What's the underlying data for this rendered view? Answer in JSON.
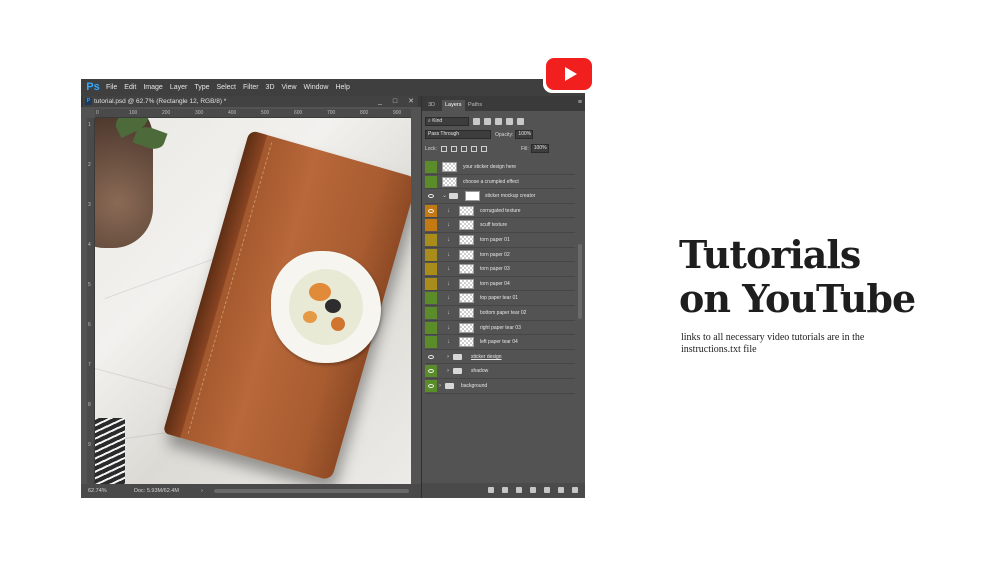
{
  "menubar": {
    "logo": "Ps",
    "items": [
      "File",
      "Edit",
      "Image",
      "Layer",
      "Type",
      "Select",
      "Filter",
      "3D",
      "View",
      "Window",
      "Help"
    ]
  },
  "document": {
    "tab_title": "tutorial.psd @ 62.7% (Rectangle 12, RGB/8) *",
    "window_controls": [
      "_",
      "□",
      "✕"
    ],
    "ruler_h": [
      "0",
      "100",
      "200",
      "300",
      "400",
      "500",
      "600",
      "700",
      "800",
      "900"
    ],
    "ruler_v": [
      "1",
      "2",
      "3",
      "4",
      "5",
      "6",
      "7",
      "8",
      "9"
    ]
  },
  "statusbar": {
    "zoom": "62.74%",
    "doc_info": "Doc: 5.93M/62.4M",
    "arrow": "›"
  },
  "panel": {
    "tabs": [
      "3D",
      "Layers",
      "Paths"
    ],
    "active_tab": "Layers",
    "menu_icon": "≡",
    "filter_kind": "Kind",
    "blend_mode": "Pass Through",
    "opacity_label": "Opacity:",
    "opacity_value": "100%",
    "lock_label": "Lock:",
    "fill_label": "Fill:",
    "fill_value": "100%",
    "layers": [
      {
        "name": "your sticker design here",
        "vis": "green",
        "eye": false,
        "thumb": "checker",
        "indent": 1
      },
      {
        "name": "choose a crumpled effect",
        "vis": "green",
        "eye": false,
        "thumb": "checker",
        "indent": 1
      },
      {
        "name": "sticker mockup creator",
        "vis": "none",
        "eye": true,
        "thumb": "folder-white",
        "indent": 0
      },
      {
        "name": "corrugated texture",
        "vis": "orange",
        "eye": true,
        "thumb": "checker",
        "indent": 2
      },
      {
        "name": "scuff texture",
        "vis": "orange",
        "eye": false,
        "thumb": "checker",
        "indent": 2
      },
      {
        "name": "torn paper 01",
        "vis": "olive",
        "eye": false,
        "thumb": "checker",
        "indent": 2
      },
      {
        "name": "torn paper 02",
        "vis": "olive",
        "eye": false,
        "thumb": "checker",
        "indent": 2
      },
      {
        "name": "torn paper 03",
        "vis": "olive",
        "eye": false,
        "thumb": "checker",
        "indent": 2
      },
      {
        "name": "torn paper 04",
        "vis": "olive",
        "eye": false,
        "thumb": "checker",
        "indent": 2
      },
      {
        "name": "top paper tear 01",
        "vis": "green",
        "eye": false,
        "thumb": "checker",
        "indent": 2
      },
      {
        "name": "bottom paper tear 02",
        "vis": "green",
        "eye": false,
        "thumb": "checker",
        "indent": 2
      },
      {
        "name": "right paper tear 03",
        "vis": "green",
        "eye": false,
        "thumb": "checker",
        "indent": 2
      },
      {
        "name": "left paper tear 04",
        "vis": "green",
        "eye": false,
        "thumb": "checker",
        "indent": 2
      },
      {
        "name": "sticker design",
        "vis": "none",
        "eye": true,
        "thumb": "folder",
        "indent": 3
      },
      {
        "name": "shadow",
        "vis": "green",
        "eye": true,
        "thumb": "folder",
        "indent": 3
      },
      {
        "name": "background",
        "vis": "green",
        "eye": true,
        "thumb": "folder",
        "indent": 4
      }
    ]
  },
  "youtube_badge": {
    "icon": "youtube-play-icon",
    "color": "#f21f1f"
  },
  "promo": {
    "headline_line1": "Tutorials",
    "headline_line2": "on YouTube",
    "subtext": "links to all necessary video tutorials are in the instructions.txt file"
  }
}
